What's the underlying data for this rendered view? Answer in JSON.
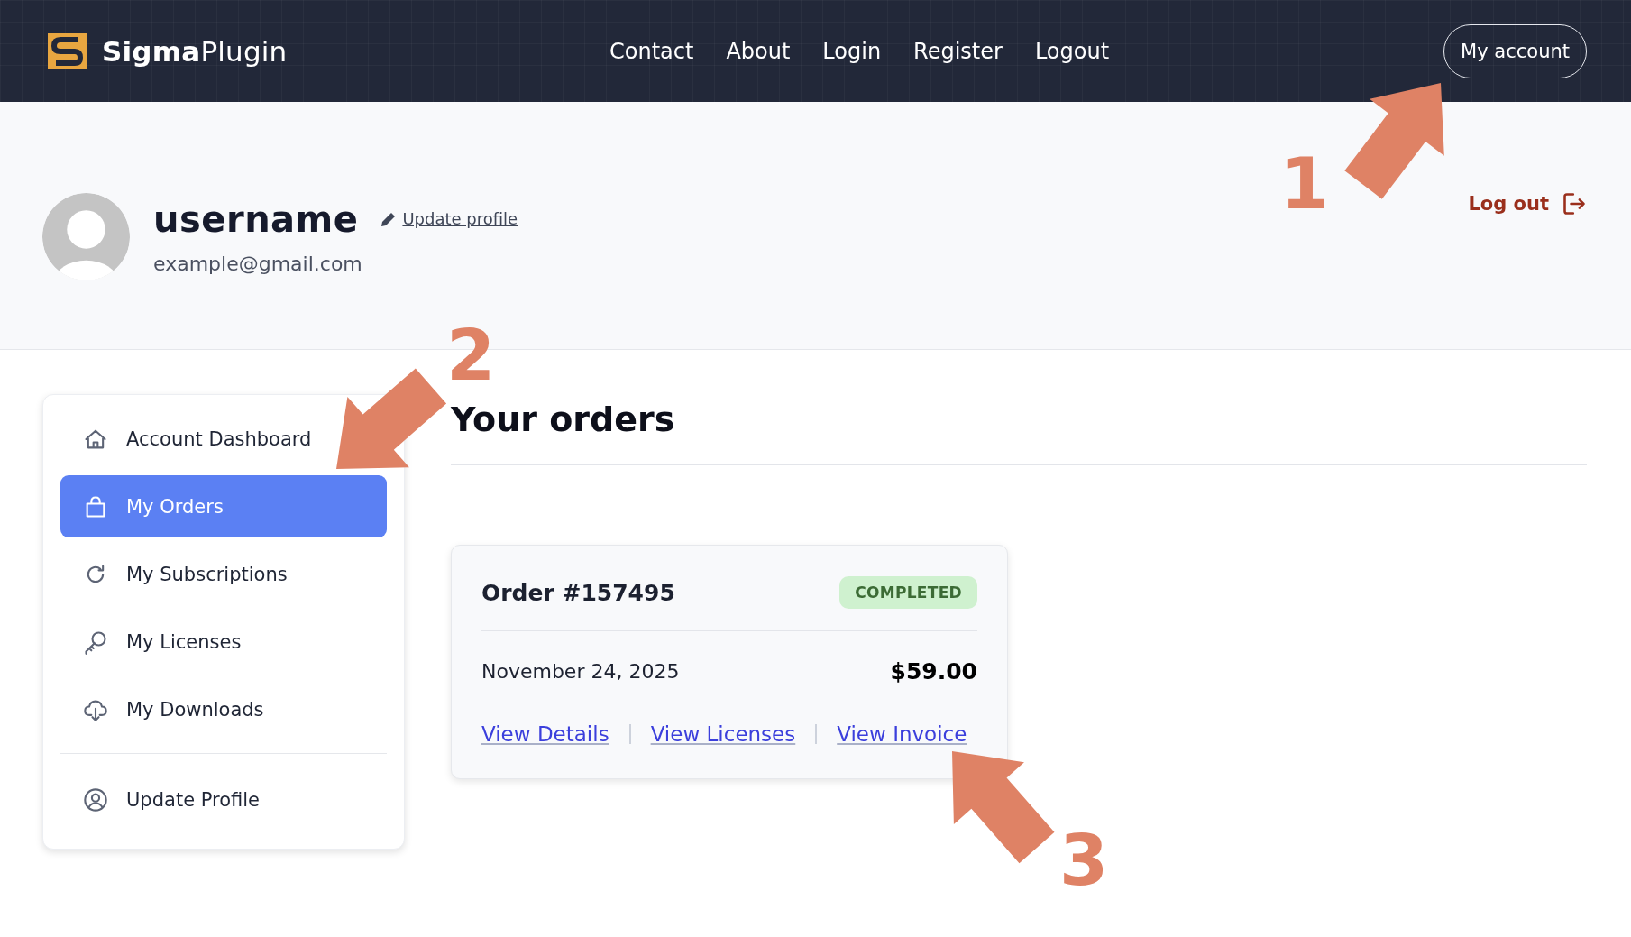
{
  "header": {
    "brand": "**Sigma**Plugin",
    "nav": [
      {
        "label": "Contact"
      },
      {
        "label": "About"
      },
      {
        "label": "Login"
      },
      {
        "label": "Register"
      },
      {
        "label": "Logout"
      }
    ],
    "account_button": "My account"
  },
  "profile": {
    "username": "username",
    "update_link": "Update profile",
    "email": "example@gmail.com",
    "logout": "Log out"
  },
  "sidebar": {
    "items": [
      {
        "label": "Account Dashboard",
        "selected": false
      },
      {
        "label": "My Orders",
        "selected": true
      },
      {
        "label": "My Subscriptions",
        "selected": false
      },
      {
        "label": "My Licenses",
        "selected": false
      },
      {
        "label": "My Downloads",
        "selected": false
      }
    ],
    "bottom_items": [
      {
        "label": "Update Profile",
        "selected": false
      }
    ]
  },
  "orders": {
    "title": "Your orders",
    "list": [
      {
        "number": "Order #157495",
        "status": "COMPLETED",
        "date": "November 24, 2025",
        "total": "$59.00",
        "links": [
          "View Details",
          "View Licenses",
          "View Invoice"
        ]
      }
    ]
  },
  "annotations": [
    {
      "label": "1"
    },
    {
      "label": "2"
    },
    {
      "label": "3"
    }
  ]
}
